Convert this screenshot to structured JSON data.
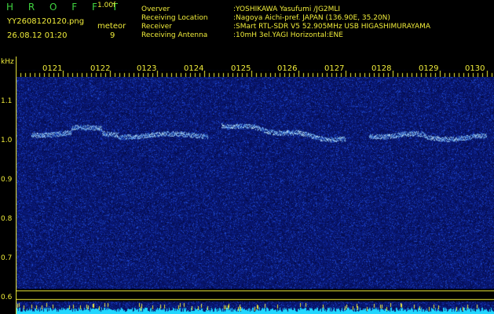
{
  "header": {
    "app_name": "H R O F F T",
    "version": "1.00f",
    "filename": "YY2608120120.png",
    "timestamp": "26.08.12 01:20",
    "meteor_label": "meteor",
    "meteor_count": "9"
  },
  "info": [
    {
      "key": "Overver",
      "value": ":YOSHIKAWA Yasufumi /JG2MLI"
    },
    {
      "key": "Receiving Location",
      "value": ":Nagoya Aichi-pref. JAPAN (136.90E, 35.20N)"
    },
    {
      "key": "Receiver",
      "value": ":SMart RTL-SDR V5 52.905MHz USB HIGASHIMURAYAMA"
    },
    {
      "key": "Receiving Antenna",
      "value": ":10mH 3el.YAGI Horizontal:ENE"
    }
  ],
  "axis": {
    "unit": "kHz",
    "y_ticks": [
      "1.1",
      "1.0",
      "0.9",
      "0.8",
      "0.7",
      "0.6"
    ],
    "x_ticks": [
      "0121",
      "0122",
      "0123",
      "0124",
      "0125",
      "0126",
      "0127",
      "0128",
      "0129",
      "0130"
    ]
  },
  "colors": {
    "background": "#000000",
    "spectrum_base": "#0b1f8a",
    "signal": "#9fd8ff",
    "text": "#f0ec3a",
    "logo": "#3fd23f",
    "noise_floor": "#22d7ff"
  }
}
